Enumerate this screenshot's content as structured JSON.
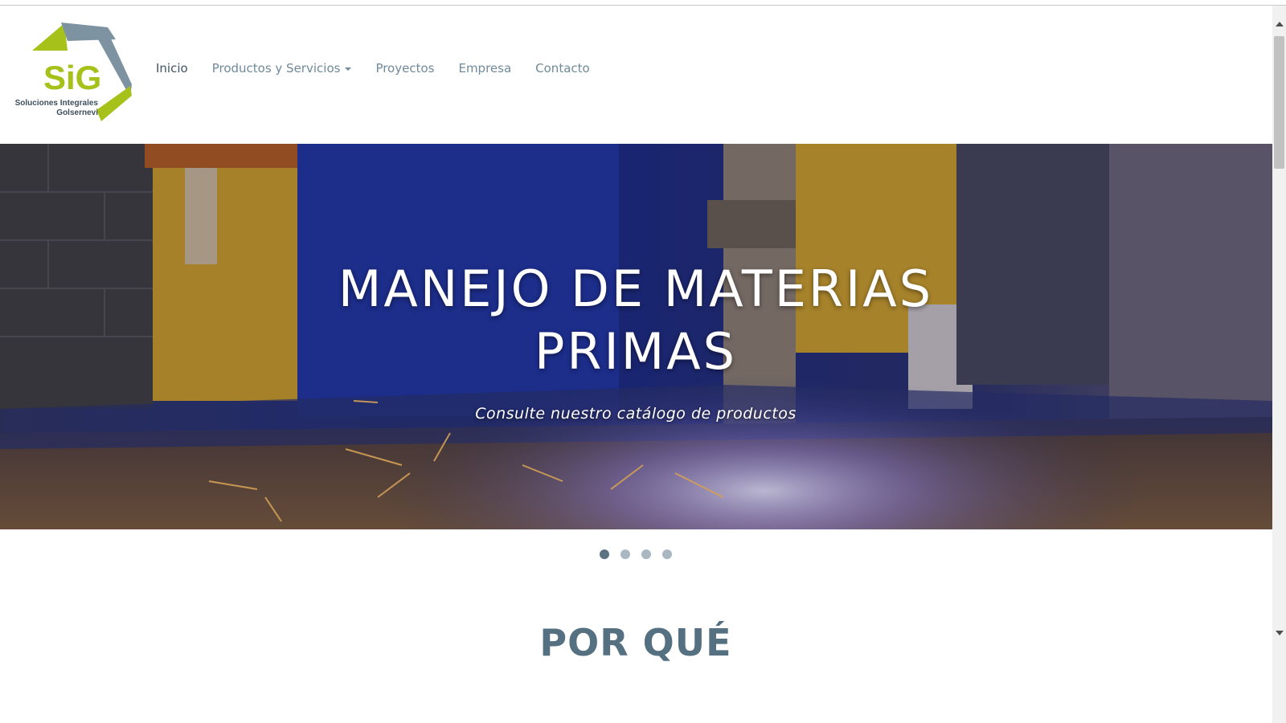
{
  "header": {
    "logo": {
      "mark": "SiG",
      "line1": "Soluciones Integrales",
      "line2": "Golsernevi"
    },
    "nav": [
      {
        "label": "Inicio",
        "active": true
      },
      {
        "label": "Productos y Servicios",
        "dropdown": true
      },
      {
        "label": "Proyectos"
      },
      {
        "label": "Empresa"
      },
      {
        "label": "Contacto"
      }
    ]
  },
  "hero": {
    "title_line1": "MANEJO DE MATERIAS",
    "title_line2": "PRIMAS",
    "subtitle": "Consulte nuestro catálogo de productos",
    "slides_count": 4,
    "active_slide": 1
  },
  "section": {
    "title": "POR QUÉ"
  },
  "colors": {
    "nav_text": "#6f8a9a",
    "nav_active": "#3f5566",
    "logo_green": "#a6c21a",
    "logo_gray": "#7e93a2",
    "section_title": "#557080"
  }
}
